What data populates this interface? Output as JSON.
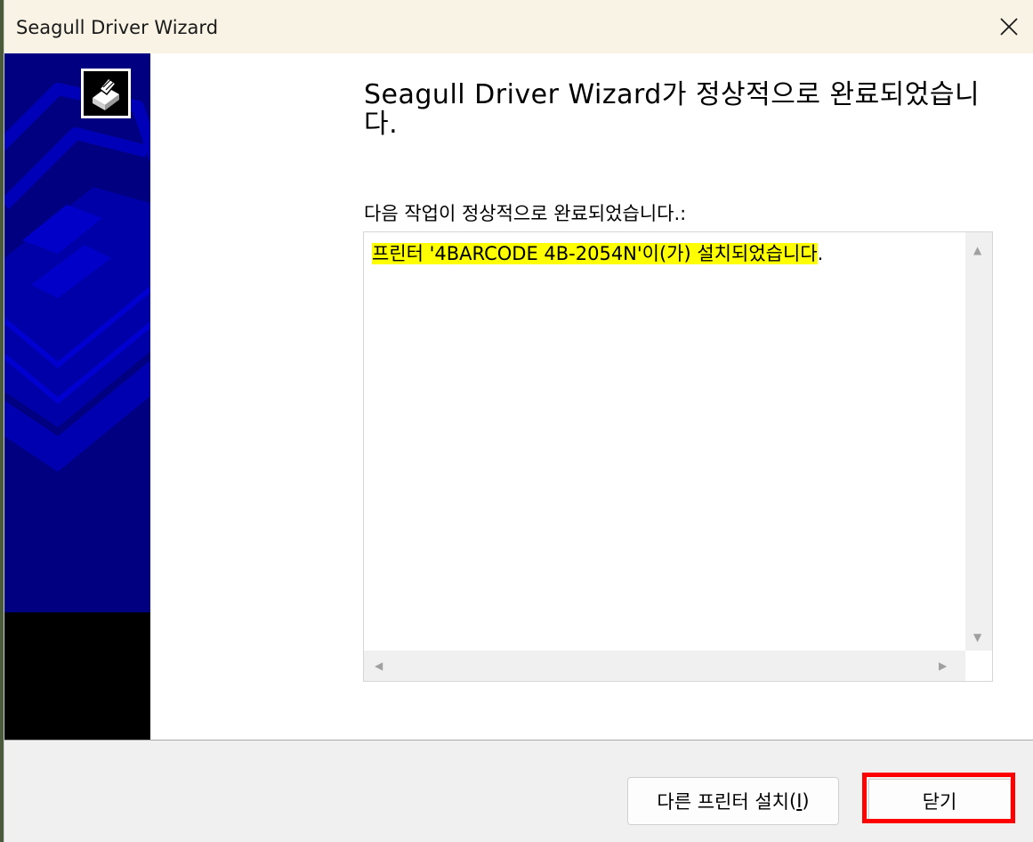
{
  "window": {
    "title": "Seagull Driver Wizard"
  },
  "sidebar": {
    "logo_icon": "printer-icon"
  },
  "content": {
    "heading": "Seagull Driver Wizard가 정상적으로 완료되었습니다.",
    "subtext": "다음 작업이 정상적으로 완료되었습니다.:",
    "log_lines": [
      {
        "highlighted": "프린터 '4BARCODE 4B-2054N'이(가) 설치되었습니다",
        "trailing": "."
      }
    ]
  },
  "buttons": {
    "install_other_label": "다른 프린터 설치",
    "install_other_paren_open": "(",
    "install_other_accel": "I",
    "install_other_paren_close": ")",
    "close_label": "닫기"
  },
  "colors": {
    "sidebar_blue": "#000080",
    "highlight_yellow": "#ffff00",
    "annotation_red": "#ff0000"
  }
}
